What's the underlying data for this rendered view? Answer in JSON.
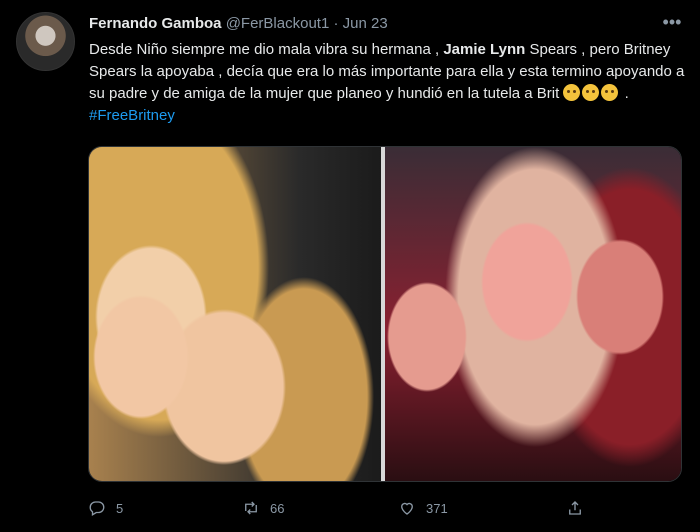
{
  "tweet": {
    "author_name": "Fernando Gamboa",
    "handle": "@FerBlackout1",
    "separator": "·",
    "date": "Jun 23",
    "text_part1": "Desde Niño siempre me dio mala vibra su hermana , ",
    "text_bold": "Jamie Lynn",
    "text_part2": " Spears , pero Britney Spears la apoyaba , decía que era lo más importante para ella y esta termino apoyando a su padre y de amiga de la mujer que planeo y hundió en la tutela a Brit ",
    "text_part3": " . ",
    "hashtag": "#FreeBritney",
    "emoji_icons": [
      "pleading-face-icon",
      "pleading-face-icon",
      "pleading-face-icon"
    ],
    "more_icon": "more-horizontal-icon"
  },
  "actions": {
    "reply_count": "5",
    "retweet_count": "66",
    "like_count": "371",
    "icons": [
      "reply-icon",
      "retweet-icon",
      "like-icon",
      "share-icon"
    ]
  },
  "colors": {
    "background": "#000000",
    "text_primary": "#e7e9ea",
    "text_secondary": "#8b98a5",
    "link": "#1d9bf0"
  }
}
